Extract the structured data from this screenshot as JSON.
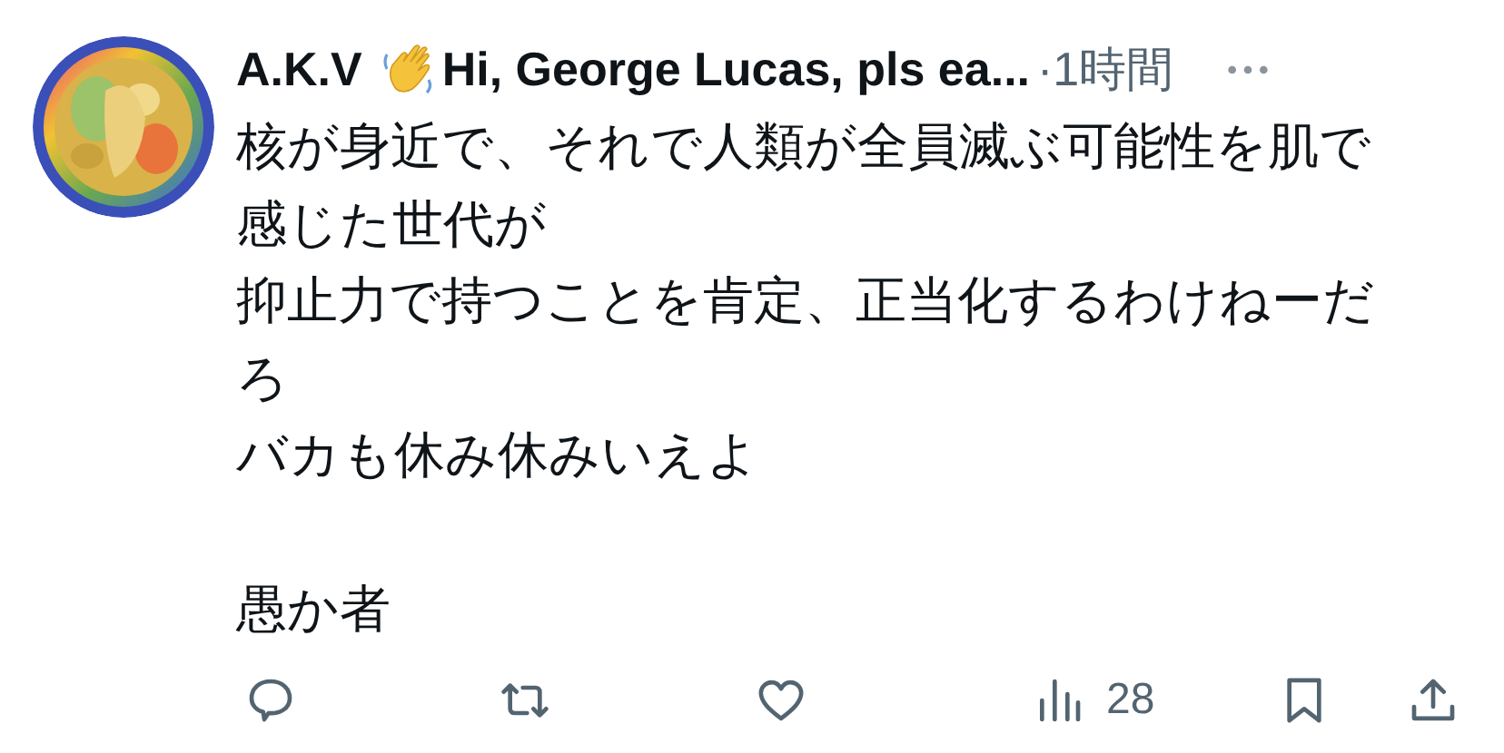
{
  "author": {
    "name_before_emoji": "A.K.V",
    "name_after_emoji": "Hi, George Lucas, pls ea...",
    "time": "·1時間"
  },
  "body": [
    "核が身近で、それで人類が全員滅ぶ可能性を肌で感じた世代が",
    "抑止力で持つことを肯定、正当化するわけねーだろ",
    "バカも休み休みいえよ"
  ],
  "closing_line": "愚か者",
  "actions": [
    {
      "kind": "reply"
    },
    {
      "kind": "repost"
    },
    {
      "kind": "like"
    },
    {
      "kind": "views",
      "count": "28"
    },
    {
      "kind": "bookmark"
    },
    {
      "kind": "share"
    }
  ]
}
